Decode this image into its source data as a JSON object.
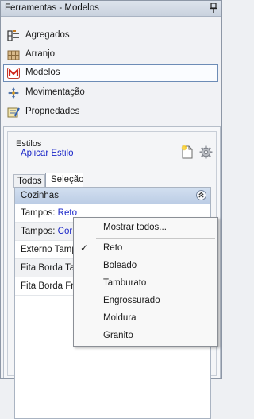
{
  "window": {
    "title": "Ferramentas - Modelos"
  },
  "menu": [
    {
      "label": "Agregados",
      "icon": "agregados-icon"
    },
    {
      "label": "Arranjo",
      "icon": "arranjo-icon"
    },
    {
      "label": "Modelos",
      "icon": "modelos-icon",
      "selected": true
    },
    {
      "label": "Movimentação",
      "icon": "movimentacao-icon"
    },
    {
      "label": "Propriedades",
      "icon": "propriedades-icon"
    }
  ],
  "estilos": {
    "title": "Estilos",
    "apply_label": "Aplicar Estilo"
  },
  "tabs": [
    {
      "label": "Todos"
    },
    {
      "label": "Seleção",
      "active": true
    }
  ],
  "grid": {
    "group": "Cozinhas",
    "rows": [
      {
        "label": "Tampos:",
        "value": "Reto"
      },
      {
        "label": "Tampos:",
        "value": "Cor"
      },
      {
        "label": "Externo Tamp",
        "value": ""
      },
      {
        "label": "Fita Borda Ta",
        "value": ""
      },
      {
        "label": "Fita Borda Fro",
        "value": ""
      }
    ]
  },
  "context_menu": {
    "show_all": "Mostrar todos...",
    "items": [
      {
        "label": "Reto",
        "checked": true
      },
      {
        "label": "Boleado"
      },
      {
        "label": "Tamburato"
      },
      {
        "label": "Engrossurado"
      },
      {
        "label": "Moldura"
      },
      {
        "label": "Granito"
      }
    ]
  },
  "colors": {
    "link": "#1a26c8",
    "header_blue": "#c6d5ea",
    "selection_border": "#6d8cb6"
  }
}
